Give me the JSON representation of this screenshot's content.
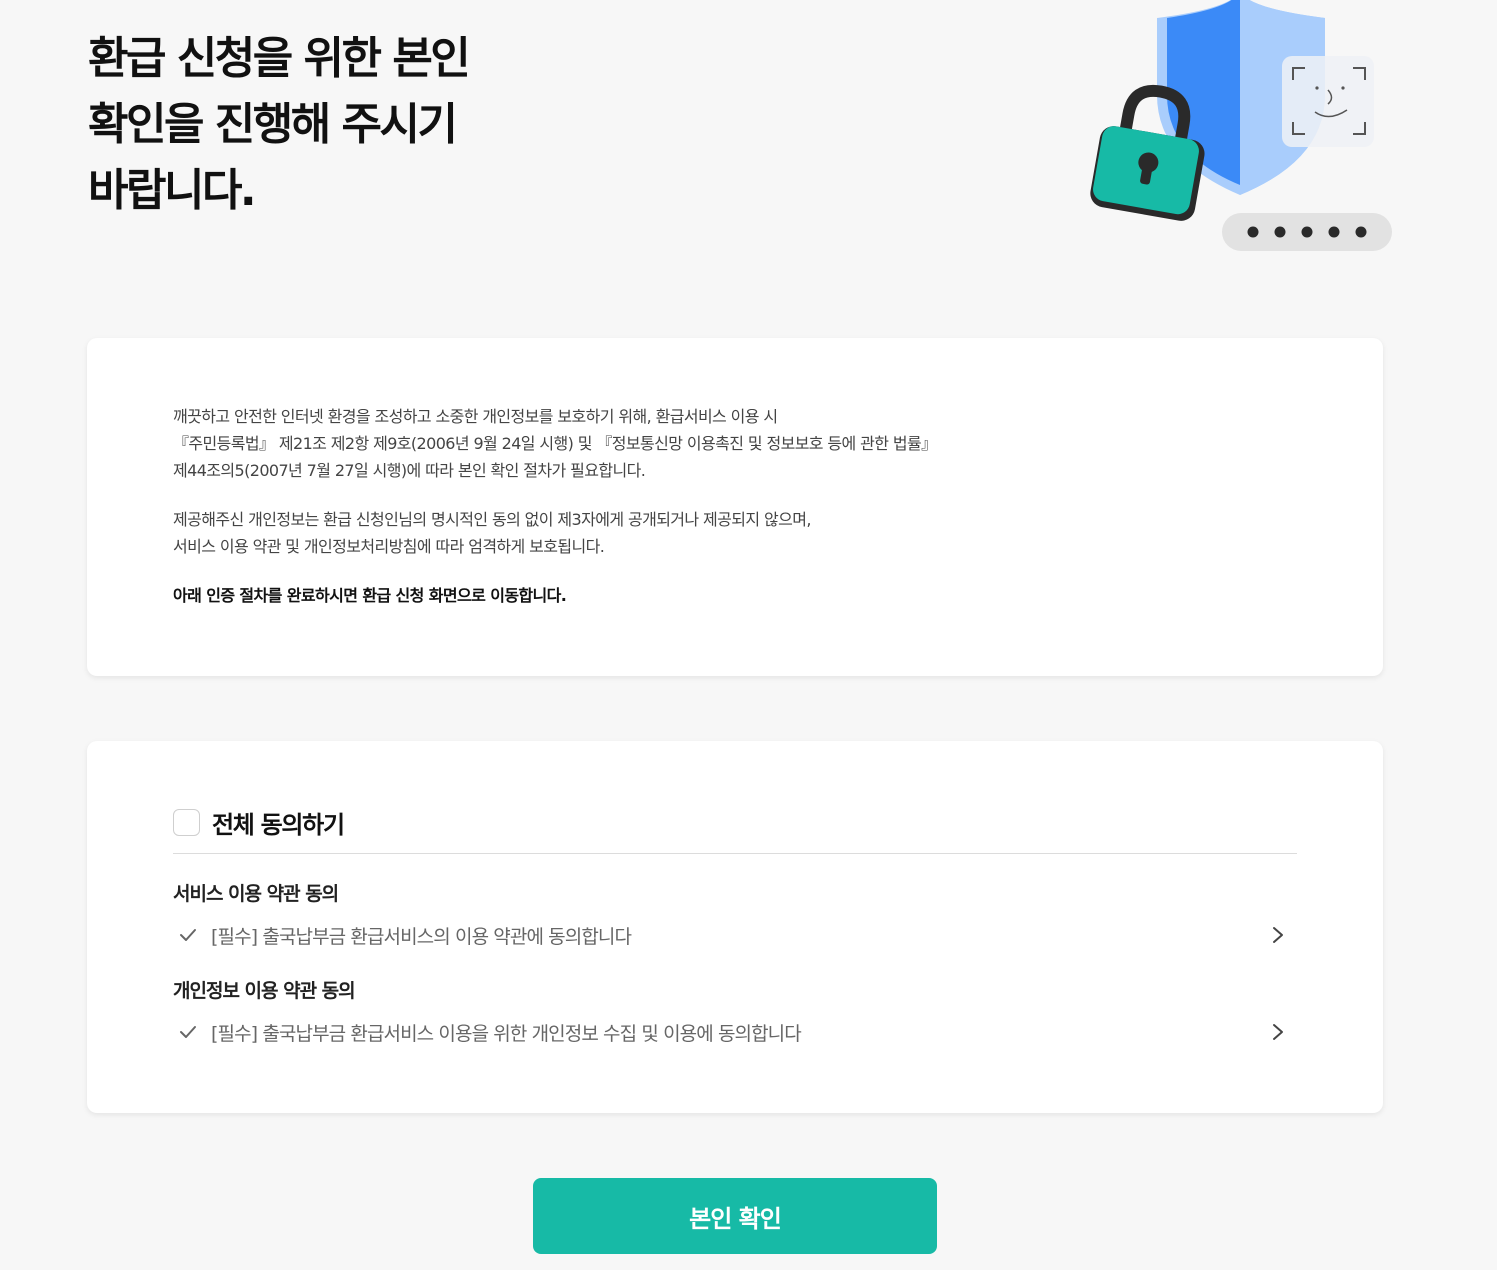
{
  "hero": {
    "title": "환급 신청을 위한 본인\n확인을 진행해 주시기\n바랍니다."
  },
  "illustration": {
    "icons": [
      "shield-icon",
      "padlock-icon",
      "face-id-icon",
      "password-dots-icon"
    ],
    "colors": {
      "shield": "#3b8af7",
      "shield_light": "#a9cdfc",
      "lock_body": "#17baa6",
      "lock_outline": "#2a2a2a"
    }
  },
  "notice": {
    "paragraph1": [
      "깨끗하고 안전한 인터넷 환경을 조성하고 소중한 개인정보를 보호하기 위해, 환급서비스 이용 시",
      "『주민등록법』 제21조 제2항 제9호(2006년 9월 24일 시행) 및 『정보통신망 이용촉진 및 정보보호 등에 관한 법률』",
      "제44조의5(2007년 7월 27일 시행)에 따라 본인 확인 절차가 필요합니다."
    ],
    "paragraph2": [
      "제공해주신 개인정보는 환급 신청인님의 명시적인 동의 없이 제3자에게 공개되거나 제공되지 않으며,",
      "서비스 이용 약관 및 개인정보처리방침에 따라 엄격하게 보호됩니다."
    ],
    "paragraph3": "아래 인증 절차를 완료하시면 환급 신청 화면으로 이동합니다."
  },
  "consent": {
    "agree_all_label": "전체 동의하기",
    "agree_all_checked": false,
    "sections": [
      {
        "title": "서비스 이용 약관 동의",
        "item": "[필수] 출국납부금 환급서비스의 이용 약관에 동의합니다"
      },
      {
        "title": "개인정보 이용 약관 동의",
        "item": "[필수] 출국납부금 환급서비스 이용을 위한 개인정보 수집 및 이용에 동의합니다"
      }
    ]
  },
  "confirm_button": {
    "label": "본인 확인",
    "color": "#17baa6"
  }
}
